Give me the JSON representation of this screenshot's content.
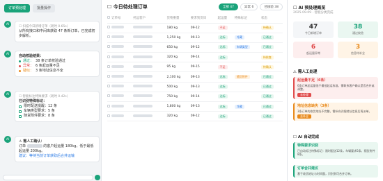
{
  "left": {
    "tabs": [
      "订单预处理",
      "批量操作"
    ],
    "msg1": {
      "time": "☐ 扫描今日新增订单（耗时 0.65s）",
      "text": "从所有接口和中间库获取 47 条新订单，已完成初步解析。"
    },
    "msg2": {
      "title": "自动校验结果：",
      "items": [
        {
          "label": "通过：",
          "value": "38 条订单校验通过"
        },
        {
          "label": "异常：",
          "value": "6 条起运量不足"
        },
        {
          "label": "疑似：",
          "value": "3 条地址信息不全"
        }
      ]
    },
    "msg3": {
      "time": "☐ 智能标注特殊要求（耗时 0.42s）",
      "title": "已识别特殊标记：",
      "items": [
        "限时配送提醒：12 条",
        "车辆类型要求：5 条",
        "随货附件要求：8 条"
      ]
    },
    "msg4": {
      "title": "⚠ 需人工确认：",
      "text_pre": "订单",
      "text_mid": "的客户起运量 180kg，低于最低起运量 200kg。",
      "link": "建议：等待当前订单获取后合并运输"
    }
  },
  "mid": {
    "title": "☐ 今日待处理订单",
    "filters": [
      "全部 47",
      "异常 6",
      "已核验 38"
    ],
    "headers": [
      "订单号",
      "托运客户",
      "货物重量",
      "要求到货日",
      "起运量",
      "特殊标记",
      "状态"
    ],
    "rows": [
      {
        "weight": "180 kg",
        "date": "09-12",
        "qty": "不足",
        "qty_c": "tr",
        "mark": "",
        "mark_c": "",
        "status": "待确认",
        "status_c": "tp"
      },
      {
        "weight": "1,250 kg",
        "date": "09-13",
        "qty": "达标",
        "qty_c": "tg",
        "mark": "冷藏",
        "mark_c": "tb",
        "status": "已通过",
        "status_c": "tg"
      },
      {
        "weight": "650 kg",
        "date": "09-12",
        "qty": "达标",
        "qty_c": "tg",
        "mark": "车辆类型",
        "mark_c": "tb",
        "status": "已通过",
        "status_c": "tg"
      },
      {
        "weight": "320 kg",
        "date": "09-14",
        "qty": "达标",
        "qty_c": "tg",
        "mark": "",
        "mark_c": "",
        "status": "待核查",
        "status_c": "tp"
      },
      {
        "weight": "95 kg",
        "date": "09-15",
        "qty": "不足",
        "qty_c": "tr",
        "mark": "",
        "mark_c": "",
        "status": "待确认",
        "status_c": "tp"
      },
      {
        "weight": "2,100 kg",
        "date": "09-13",
        "qty": "达标",
        "qty_c": "tg",
        "mark": "随货附件",
        "mark_c": "to",
        "status": "已通过",
        "status_c": "tg"
      },
      {
        "weight": "500 kg",
        "date": "09-13",
        "qty": "达标",
        "qty_c": "tg",
        "mark": "",
        "mark_c": "",
        "status": "已通过",
        "status_c": "tg"
      },
      {
        "weight": "750 kg",
        "date": "09-14",
        "qty": "达标",
        "qty_c": "tg",
        "mark": "",
        "mark_c": "",
        "status": "已通过",
        "status_c": "tg"
      },
      {
        "weight": "1,800 kg",
        "date": "09-13",
        "qty": "达标",
        "qty_c": "tg",
        "mark": "冷藏",
        "mark_c": "tb",
        "status": "已通过",
        "status_c": "tg"
      },
      {
        "weight": "320 kg",
        "date": "09-12",
        "qty": "达标",
        "qty_c": "tg",
        "mark": "",
        "mark_c": "",
        "status": "已通过",
        "status_c": "tg"
      }
    ]
  },
  "right": {
    "title": "☐ AI 预处理概览",
    "sub": "2025-09-09 · 智能分类完成",
    "stats": [
      {
        "n": "47",
        "l": "今日新增订单",
        "color": "#333333",
        "bg": "#f4f6f8"
      },
      {
        "n": "38",
        "l": "通过校验",
        "color": "#1aa37a",
        "bg": "#eaf7f1"
      },
      {
        "n": "6",
        "l": "起运量异常",
        "color": "#e04b4b",
        "bg": "#fdeeee"
      },
      {
        "n": "3",
        "l": "信息待补全",
        "color": "#e8891a",
        "bg": "#fff4e6"
      }
    ],
    "sec1": "⚠ 需人工处理",
    "card1": {
      "title": "起运量不足（6条）",
      "text": "6条订单起运量低于最低起运标准，需联系客户确认是否合并或调整。",
      "btn": "去处理"
    },
    "card2": {
      "title": "地址信息缺失（3条）",
      "text": "3条订单的收货地址不完整，需补充详细地址信息后再派单。",
      "btn": "去补全"
    },
    "sec2": "☐ AI 自动完成",
    "card3": {
      "title": "特殊要求识别",
      "text": "已自动标注特殊标记：限时配送12条，车辆要求5条，随货附件8条。"
    },
    "card4": {
      "title": "订单合并建议",
      "text": "基于收货地址与时间窗，识别到可合并订单。"
    }
  }
}
